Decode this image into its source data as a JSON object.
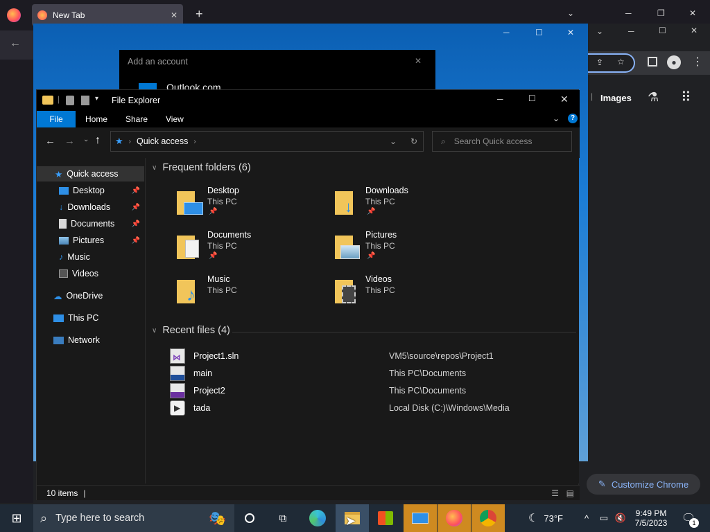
{
  "firefox": {
    "tab_title": "New Tab"
  },
  "chrome": {
    "images_link": "Images",
    "customize_label": "Customize Chrome"
  },
  "mail_dialog": {
    "title": "Add an account",
    "option": "Outlook.com"
  },
  "explorer": {
    "title": "File Explorer",
    "ribbon_tabs": [
      "File",
      "Home",
      "Share",
      "View"
    ],
    "address": "Quick access",
    "search_placeholder": "Search Quick access",
    "nav": {
      "quick_access": "Quick access",
      "pinned": [
        "Desktop",
        "Downloads",
        "Documents",
        "Pictures"
      ],
      "unpinned": [
        "Music",
        "Videos"
      ],
      "onedrive": "OneDrive",
      "this_pc": "This PC",
      "network": "Network"
    },
    "frequent_header": "Frequent folders (6)",
    "folders": [
      {
        "name": "Desktop",
        "location": "This PC",
        "pinned": true,
        "icon": "desktop-folder"
      },
      {
        "name": "Downloads",
        "location": "This PC",
        "pinned": true,
        "icon": "downloads-folder"
      },
      {
        "name": "Documents",
        "location": "This PC",
        "pinned": true,
        "icon": "documents-folder"
      },
      {
        "name": "Pictures",
        "location": "This PC",
        "pinned": true,
        "icon": "pictures-folder"
      },
      {
        "name": "Music",
        "location": "This PC",
        "pinned": false,
        "icon": "music-folder"
      },
      {
        "name": "Videos",
        "location": "This PC",
        "pinned": false,
        "icon": "videos-folder"
      }
    ],
    "recent_header": "Recent files (4)",
    "recent": [
      {
        "name": "Project1.sln",
        "path": "VM5\\source\\repos\\Project1",
        "icon": "sln-file"
      },
      {
        "name": "main",
        "path": "This PC\\Documents",
        "icon": "cpp-file"
      },
      {
        "name": "Project2",
        "path": "This PC\\Documents",
        "icon": "dev-file"
      },
      {
        "name": "tada",
        "path": "Local Disk (C:)\\Windows\\Media",
        "icon": "audio-file"
      }
    ],
    "status_items": "10 items"
  },
  "taskbar": {
    "search_placeholder": "Type here to search",
    "weather": "73°F",
    "time": "9:49 PM",
    "date": "7/5/2023",
    "notification_count": "1"
  },
  "colors": {
    "accent": "#0078d4",
    "folder": "#f1c55a"
  }
}
